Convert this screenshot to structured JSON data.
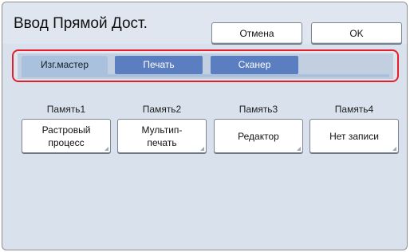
{
  "header": {
    "title": "Ввод Прямой Дост.",
    "cancel_label": "Отмена",
    "ok_label": "OK"
  },
  "tabs": [
    {
      "label": "Изг.мастер",
      "active": true
    },
    {
      "label": "Печать",
      "active": false
    },
    {
      "label": "Сканер",
      "active": false
    }
  ],
  "memories": [
    {
      "label": "Память1",
      "line1": "Растровый",
      "line2": "процесс"
    },
    {
      "label": "Память2",
      "line1": "Мультип-",
      "line2": "печать"
    },
    {
      "label": "Память3",
      "line1": "Редактор",
      "line2": ""
    },
    {
      "label": "Память4",
      "line1": "Нет записи",
      "line2": ""
    }
  ],
  "colors": {
    "panel_bg": "#d9e1ec",
    "active_tab": "#a9c1dc",
    "inactive_tab": "#5b7ec0",
    "highlight_border": "#e41e2b"
  }
}
